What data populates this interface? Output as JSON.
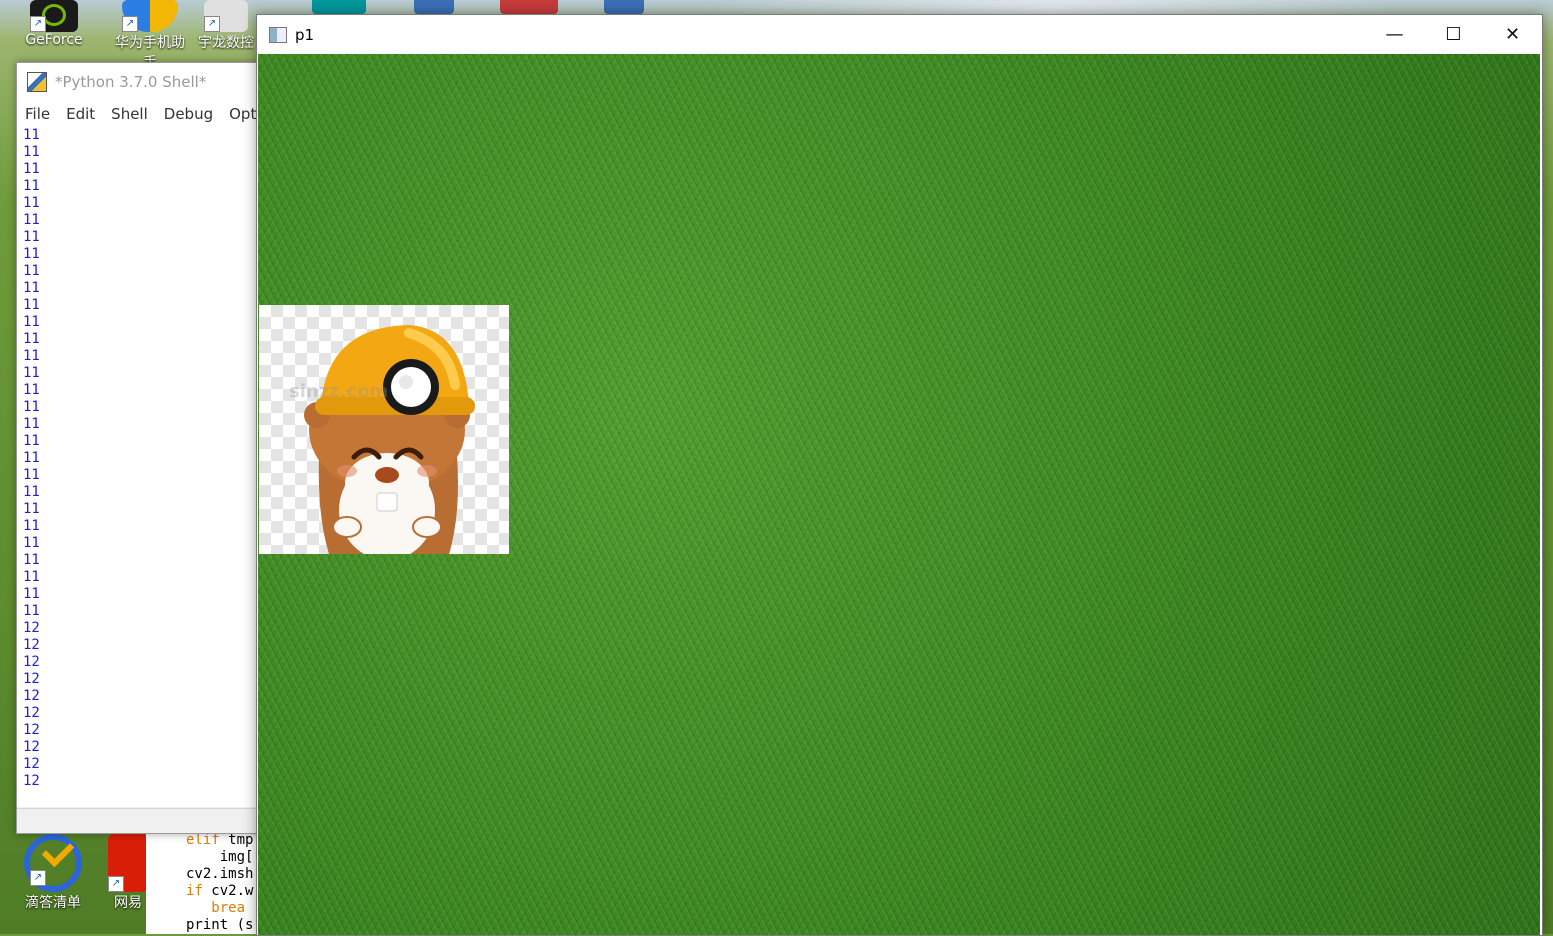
{
  "desktop": {
    "icons": [
      {
        "label": "GeForce",
        "icon": "nvidia-icon"
      },
      {
        "label": "华为手机助手",
        "icon": "huawei-shield-icon"
      },
      {
        "label": "宇龙数控",
        "icon": "cnc-icon"
      },
      {
        "label": "滴答清单",
        "icon": "ticktick-icon"
      },
      {
        "label": "网易",
        "icon": "netease-icon"
      }
    ]
  },
  "idle_shell": {
    "title": "*Python 3.7.0 Shell*",
    "menu": [
      "File",
      "Edit",
      "Shell",
      "Debug",
      "Optio"
    ],
    "output_lines": [
      "11",
      "11",
      "11",
      "11",
      "11",
      "11",
      "11",
      "11",
      "11",
      "11",
      "11",
      "11",
      "11",
      "11",
      "11",
      "11",
      "11",
      "11",
      "11",
      "11",
      "11",
      "11",
      "11",
      "11",
      "11",
      "11",
      "11",
      "11",
      "11",
      "12",
      "12",
      "12",
      "12",
      "12",
      "12",
      "12",
      "12",
      "12",
      "12"
    ]
  },
  "editor_fragment": {
    "lines": [
      {
        "kw": "elif",
        "rest": " tmp"
      },
      {
        "kw": "",
        "rest": "    img["
      },
      {
        "kw": "",
        "rest": "cv2.imsh"
      },
      {
        "kw": "if",
        "rest": " cv2.w"
      },
      {
        "kw": "   brea",
        "rest": ""
      },
      {
        "kw": "",
        "rest": "print (s"
      }
    ]
  },
  "cv_window": {
    "title": "p1",
    "controls": {
      "minimize": "—",
      "maximize": "☐",
      "close": "✕"
    },
    "watermark": "sinzz.com"
  },
  "colors": {
    "grass": "#3d8a22",
    "helmet": "#f3a712",
    "mole_fur": "#b86d33",
    "code_blue": "#1f1fd6",
    "keyword_orange": "#e07b00"
  }
}
